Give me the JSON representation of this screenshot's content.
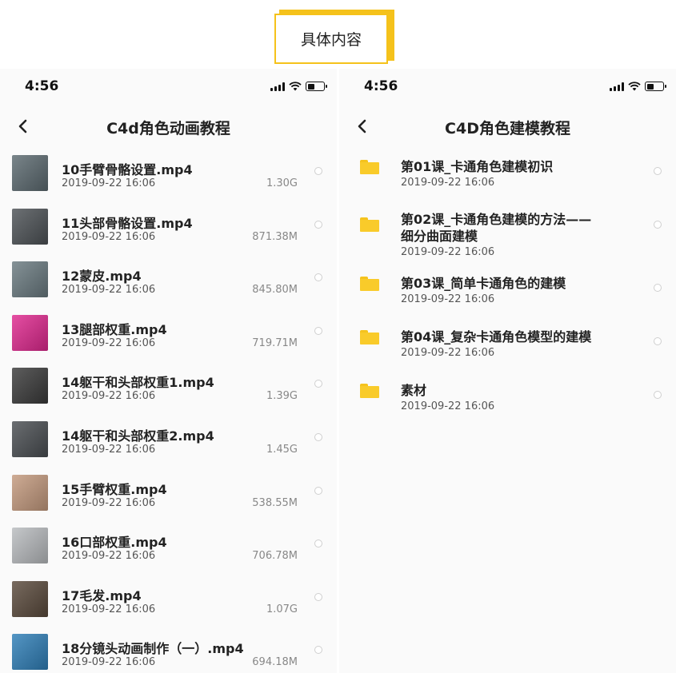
{
  "header_tag": {
    "label": "具体内容"
  },
  "left_phone": {
    "status": {
      "time": "4:56"
    },
    "title": "C4d角色动画教程",
    "files": [
      {
        "name": "10手臂骨骼设置.mp4",
        "date": "2019-09-22 16:06",
        "size": "1.30G",
        "thumb_color": "#5c6a70"
      },
      {
        "name": "11头部骨骼设置.mp4",
        "date": "2019-09-22 16:06",
        "size": "871.38M",
        "thumb_color": "#4d5256"
      },
      {
        "name": "12蒙皮.mp4",
        "date": "2019-09-22 16:06",
        "size": "845.80M",
        "thumb_color": "#6a7a80"
      },
      {
        "name": "13腿部权重.mp4",
        "date": "2019-09-22 16:06",
        "size": "719.71M",
        "thumb_color": "#e0288f"
      },
      {
        "name": "14躯干和头部权重1.mp4",
        "date": "2019-09-22 16:06",
        "size": "1.39G",
        "thumb_color": "#3a3a3a"
      },
      {
        "name": "14躯干和头部权重2.mp4",
        "date": "2019-09-22 16:06",
        "size": "1.45G",
        "thumb_color": "#4a4e52"
      },
      {
        "name": "15手臂权重.mp4",
        "date": "2019-09-22 16:06",
        "size": "538.55M",
        "thumb_color": "#c49a7e"
      },
      {
        "name": "16口部权重.mp4",
        "date": "2019-09-22 16:06",
        "size": "706.78M",
        "thumb_color": "#b9bcbf"
      },
      {
        "name": "17毛发.mp4",
        "date": "2019-09-22 16:06",
        "size": "1.07G",
        "thumb_color": "#5a4a3c"
      },
      {
        "name": "18分镜头动画制作（一）.mp4",
        "date": "2019-09-22 16:06",
        "size": "694.18M",
        "thumb_color": "#2f7fb8"
      }
    ]
  },
  "right_phone": {
    "status": {
      "time": "4:56"
    },
    "title": "C4D角色建模教程",
    "folders": [
      {
        "name_lines": [
          "第01课_卡通角色建模初识"
        ],
        "date": "2019-09-22 16:06"
      },
      {
        "name_lines": [
          "第02课_卡通角色建模的方法——",
          "细分曲面建模"
        ],
        "date": "2019-09-22 16:06"
      },
      {
        "name_lines": [
          "第03课_简单卡通角色的建模"
        ],
        "date": "2019-09-22 16:06"
      },
      {
        "name_lines": [
          "第04课_复杂卡通角色模型的建模"
        ],
        "date": "2019-09-22 16:06"
      },
      {
        "name_lines": [
          "素材"
        ],
        "date": "2019-09-22 16:06"
      }
    ]
  },
  "colors": {
    "accent": "#f5c21b",
    "folder": "#f9cb2a"
  },
  "icons": {
    "back": "chevron-left-icon",
    "folder": "folder-icon",
    "signal": "signal-icon",
    "wifi": "wifi-icon",
    "battery": "battery-icon"
  }
}
